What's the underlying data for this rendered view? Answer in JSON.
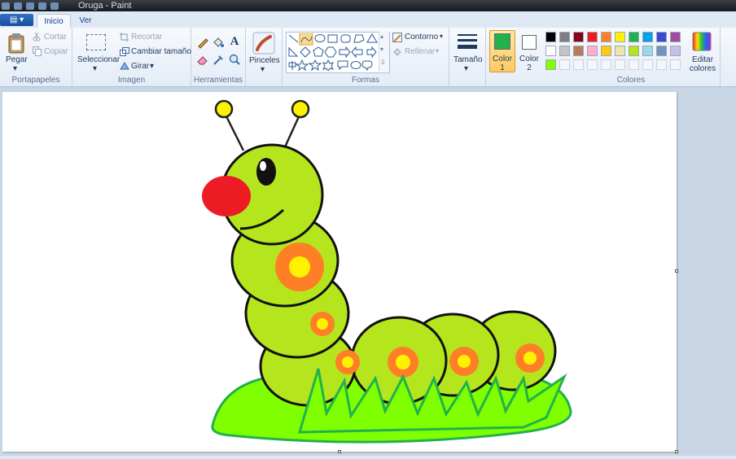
{
  "window": {
    "title": "Oruga - Paint"
  },
  "tabs": {
    "file": "▤ ▾",
    "home": "Inicio",
    "view": "Ver"
  },
  "clipboard": {
    "paste": "Pegar",
    "cut": "Cortar",
    "copy": "Copiar",
    "label": "Portapapeles"
  },
  "image": {
    "select": "Seleccionar",
    "crop": "Recortar",
    "resize": "Cambiar tamaño",
    "rotate": "Girar",
    "label": "Imagen"
  },
  "tools": {
    "label": "Herramientas",
    "text_tool": "A"
  },
  "brushes": {
    "label": "Pinceles"
  },
  "shapes": {
    "outline": "Contorno",
    "fill": "Rellenar",
    "label": "Formas"
  },
  "size": {
    "label": "Tamaño"
  },
  "color1": {
    "label": "Color\n1",
    "value": "#22b14c"
  },
  "color2": {
    "label": "Color\n2",
    "value": "#ffffff"
  },
  "colors": {
    "label": "Colores",
    "edit": "Editar colores",
    "palette_row1": [
      "#000000",
      "#7f7f7f",
      "#880015",
      "#ed1c24",
      "#ff7f27",
      "#fff200",
      "#22b14c",
      "#00a2e8",
      "#3f48cc",
      "#a349a4"
    ],
    "palette_row2": [
      "#ffffff",
      "#c3c3c3",
      "#b97a57",
      "#ffaec9",
      "#ffc90e",
      "#efe4b0",
      "#b5e61d",
      "#99d9ea",
      "#7092be",
      "#c8bfe7"
    ],
    "palette_row3": [
      "#80ff00",
      "",
      "",
      "",
      "",
      "",
      "",
      "",
      "",
      ""
    ]
  },
  "drawing": {
    "body_color": "#b5e61d",
    "nose_color": "#ed1c24",
    "spot_outer": "#ff7f27",
    "spot_inner": "#fff200",
    "grass_color": "#80ff00",
    "grass_outline": "#22b14c",
    "antenna_tip": "#fff200"
  }
}
